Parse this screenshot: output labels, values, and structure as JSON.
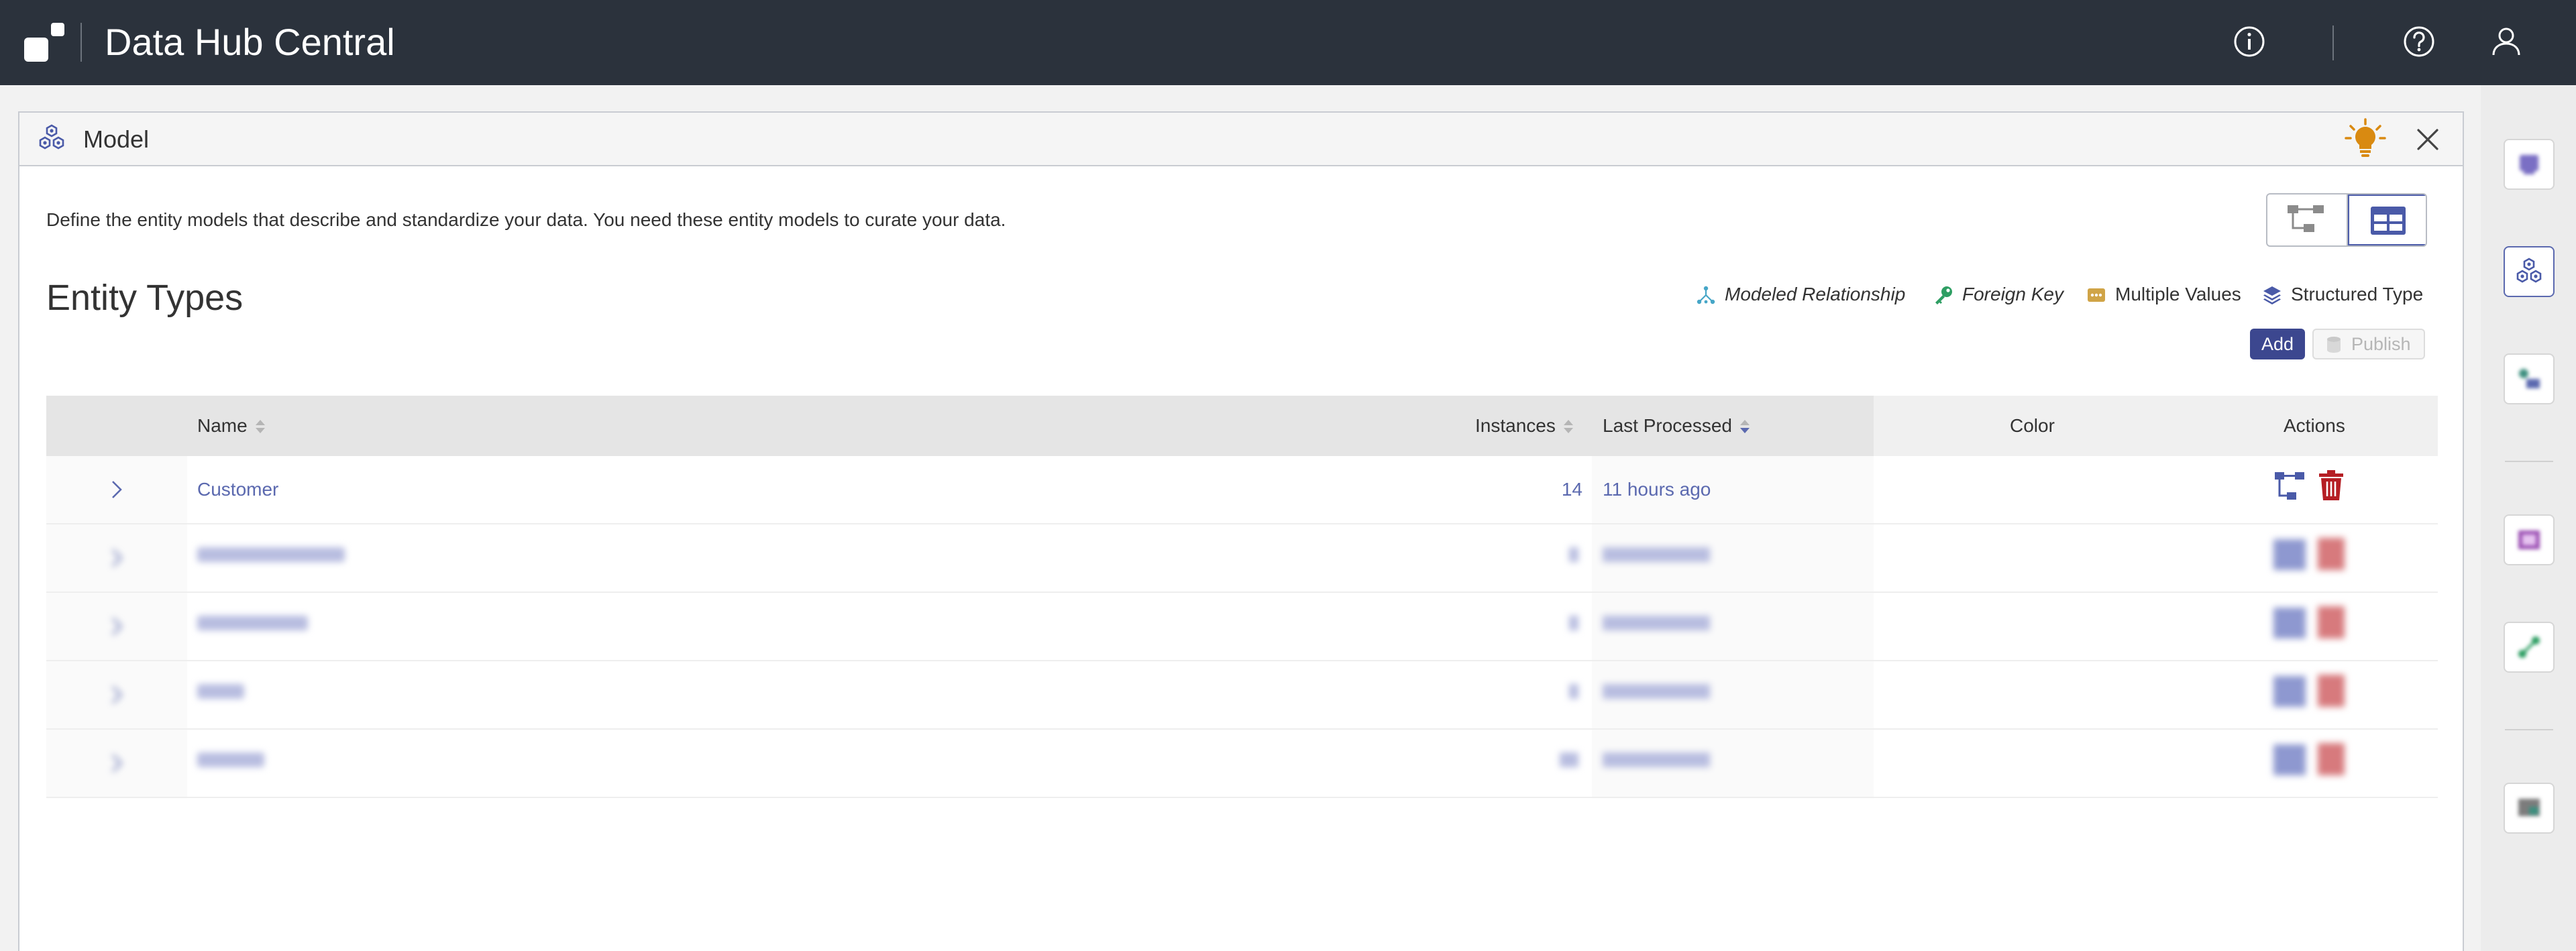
{
  "header": {
    "app_title": "Data Hub Central",
    "icons": [
      "info-icon",
      "help-icon",
      "user-icon"
    ]
  },
  "rail": {
    "items": [
      "explore-icon",
      "model-icon",
      "load-icon",
      "curate-icon",
      "run-icon",
      "monitor-icon"
    ],
    "active": "model-icon"
  },
  "panel": {
    "title": "Model",
    "description": "Define the entity models that describe and standardize your data. You need these entity models to curate your data.",
    "section_title": "Entity Types",
    "legend": {
      "modeled_relationship": "Modeled Relationship",
      "foreign_key": "Foreign Key",
      "multiple_values": "Multiple Values",
      "structured_type": "Structured Type"
    },
    "buttons": {
      "add": "Add",
      "publish": "Publish"
    }
  },
  "table": {
    "headers": {
      "name": "Name",
      "instances": "Instances",
      "last_processed": "Last Processed",
      "color": "Color",
      "actions": "Actions"
    },
    "rows": [
      {
        "name": "Customer",
        "instances": "14",
        "last_processed": "11 hours ago",
        "blurred": false
      },
      {
        "name": "",
        "instances": "",
        "last_processed": "",
        "blurred": true
      },
      {
        "name": "",
        "instances": "",
        "last_processed": "",
        "blurred": true
      },
      {
        "name": "",
        "instances": "",
        "last_processed": "",
        "blurred": true
      },
      {
        "name": "",
        "instances": "",
        "last_processed": "",
        "blurred": true
      }
    ]
  },
  "colors": {
    "topbar": "#2b323c",
    "accent": "#5b69af",
    "add_button": "#3c478f",
    "delete": "#b51e24",
    "bulb": "#d98a11",
    "foreign_key": "#2e9e63",
    "multiple_values": "#d0a447",
    "modeled_relationship": "#46a6c7"
  }
}
